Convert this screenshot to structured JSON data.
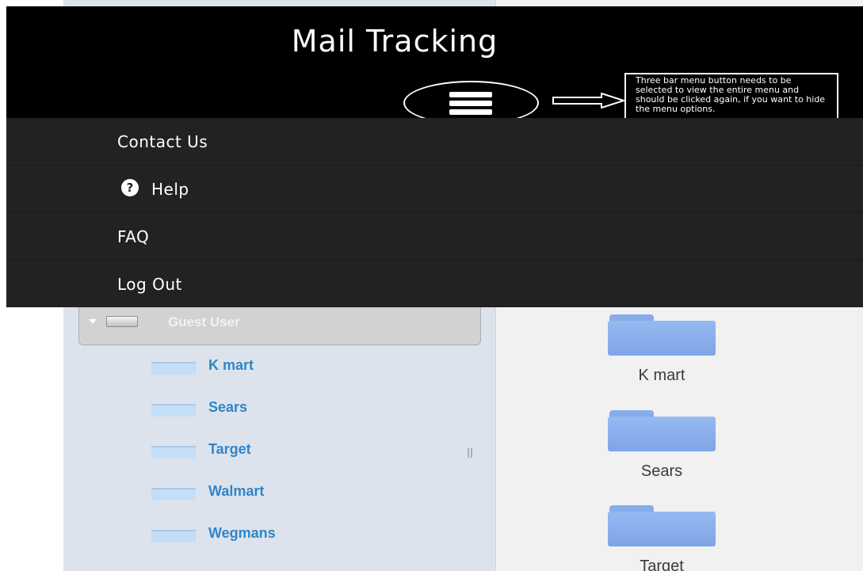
{
  "header": {
    "title": "Mail Tracking",
    "menu_button_icon": "hamburger-menu-icon",
    "callout_text": "Three bar menu button needs to be selected to view the entire menu and should be clicked again, if you want to hide the menu options."
  },
  "menu": {
    "items": [
      {
        "label": "Contact Us",
        "icon": ""
      },
      {
        "label": "Help",
        "icon": "help-icon"
      },
      {
        "label": "FAQ",
        "icon": ""
      },
      {
        "label": "Log Out",
        "icon": ""
      }
    ]
  },
  "tree": {
    "root_label": "Guest User",
    "items": [
      {
        "label": "K mart"
      },
      {
        "label": "Sears"
      },
      {
        "label": "Target"
      },
      {
        "label": "Walmart"
      },
      {
        "label": "Wegmans"
      }
    ]
  },
  "folders": {
    "items": [
      {
        "label": "K mart"
      },
      {
        "label": "Sears"
      },
      {
        "label": "Target"
      }
    ]
  },
  "colors": {
    "topbar": "#000000",
    "menu_bg": "#222222",
    "tree_link": "#2f86c9",
    "folder_blue": "#7ea5e8"
  }
}
